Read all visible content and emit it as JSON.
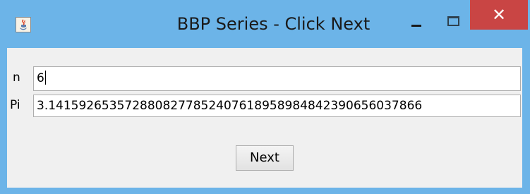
{
  "window": {
    "title": "BBP Series - Click Next",
    "close_glyph": "✕",
    "app_icon": "java-cup-icon"
  },
  "form": {
    "n_label": "n",
    "n_value": "6",
    "pi_label": "Pi",
    "pi_value": "3.1415926535728808277852407618958984842390656037866",
    "next_label": "Next"
  },
  "colors": {
    "titlebar": "#6cb4e8",
    "close_button": "#c94544",
    "client_bg": "#f0f0f0"
  }
}
